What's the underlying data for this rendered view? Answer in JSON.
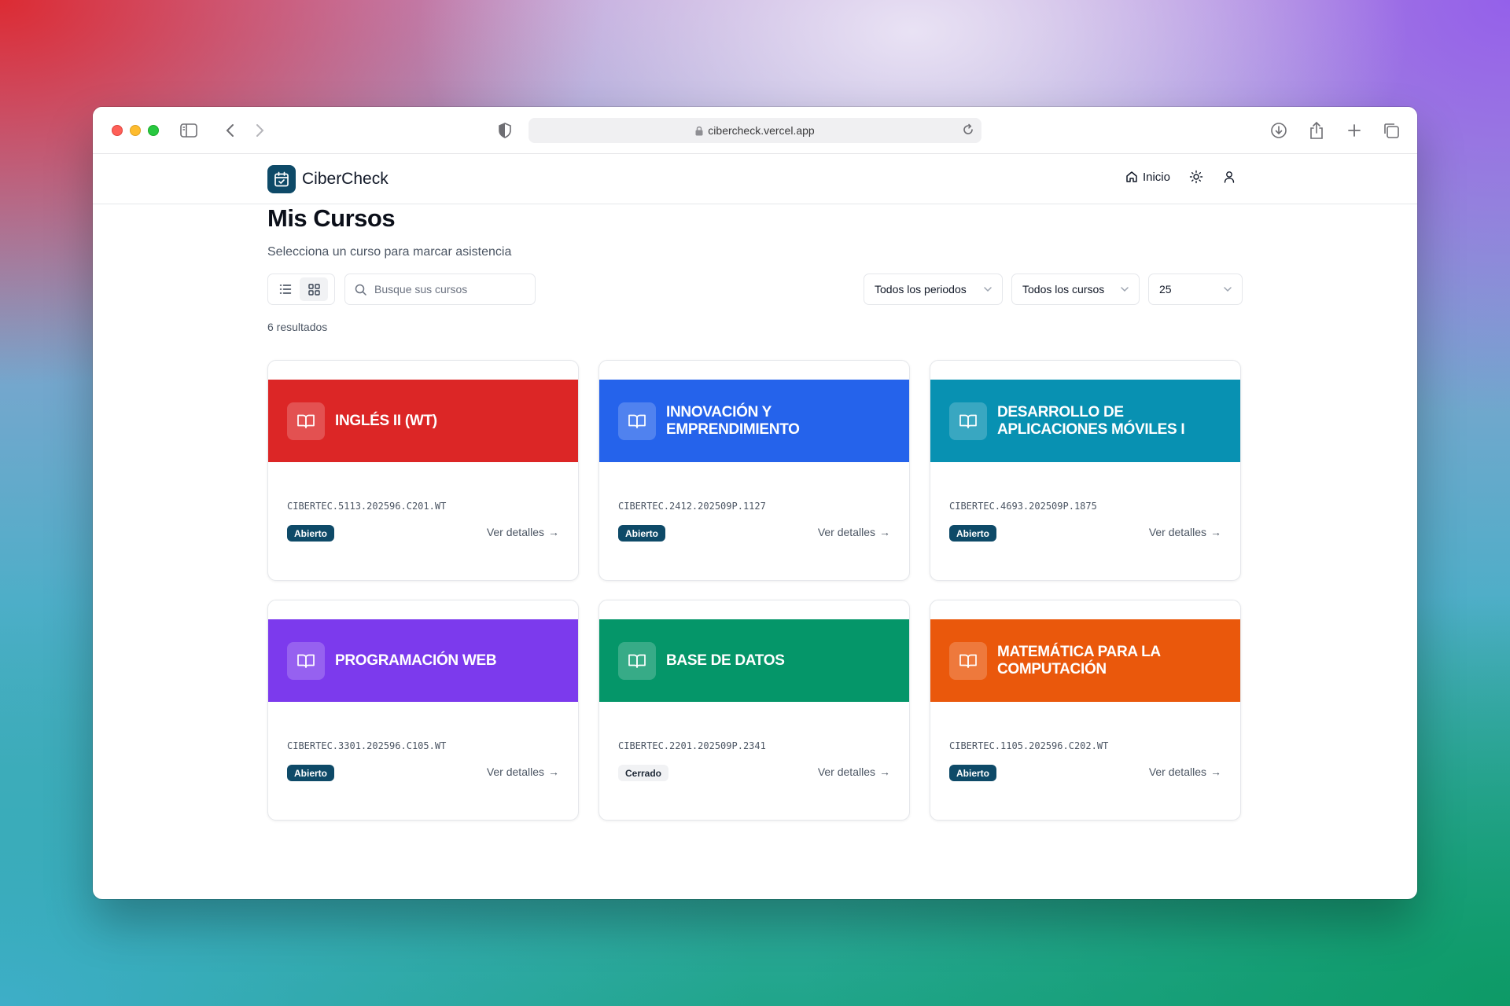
{
  "browser": {
    "url": "cibercheck.vercel.app"
  },
  "app": {
    "name": "CiberCheck",
    "nav_home": "Inicio"
  },
  "page": {
    "title": "Mis Cursos",
    "subtitle": "Selecciona un curso para marcar asistencia",
    "search_placeholder": "Busque sus cursos",
    "filter_periods": "Todos los periodos",
    "filter_courses": "Todos los cursos",
    "page_size": "25",
    "results": "6 resultados",
    "details_label": "Ver detalles",
    "details_arrow": "→"
  },
  "courses": [
    {
      "title": "INGLÉS II (WT)",
      "code": "CIBERTEC.5113.202596.C201.WT",
      "status": "Abierto",
      "color": "#dc2626"
    },
    {
      "title": "INNOVACIÓN Y EMPRENDIMIENTO",
      "code": "CIBERTEC.2412.202509P.1127",
      "status": "Abierto",
      "color": "#2563eb"
    },
    {
      "title": "DESARROLLO DE APLICACIONES MÓVILES I",
      "code": "CIBERTEC.4693.202509P.1875",
      "status": "Abierto",
      "color": "#0891b2"
    },
    {
      "title": "PROGRAMACIÓN WEB",
      "code": "CIBERTEC.3301.202596.C105.WT",
      "status": "Abierto",
      "color": "#7c3aed"
    },
    {
      "title": "BASE DE DATOS",
      "code": "CIBERTEC.2201.202509P.2341",
      "status": "Cerrado",
      "color": "#059669"
    },
    {
      "title": "MATEMÁTICA PARA LA COMPUTACIÓN",
      "code": "CIBERTEC.1105.202596.C202.WT",
      "status": "Abierto",
      "color": "#ea580c"
    }
  ]
}
